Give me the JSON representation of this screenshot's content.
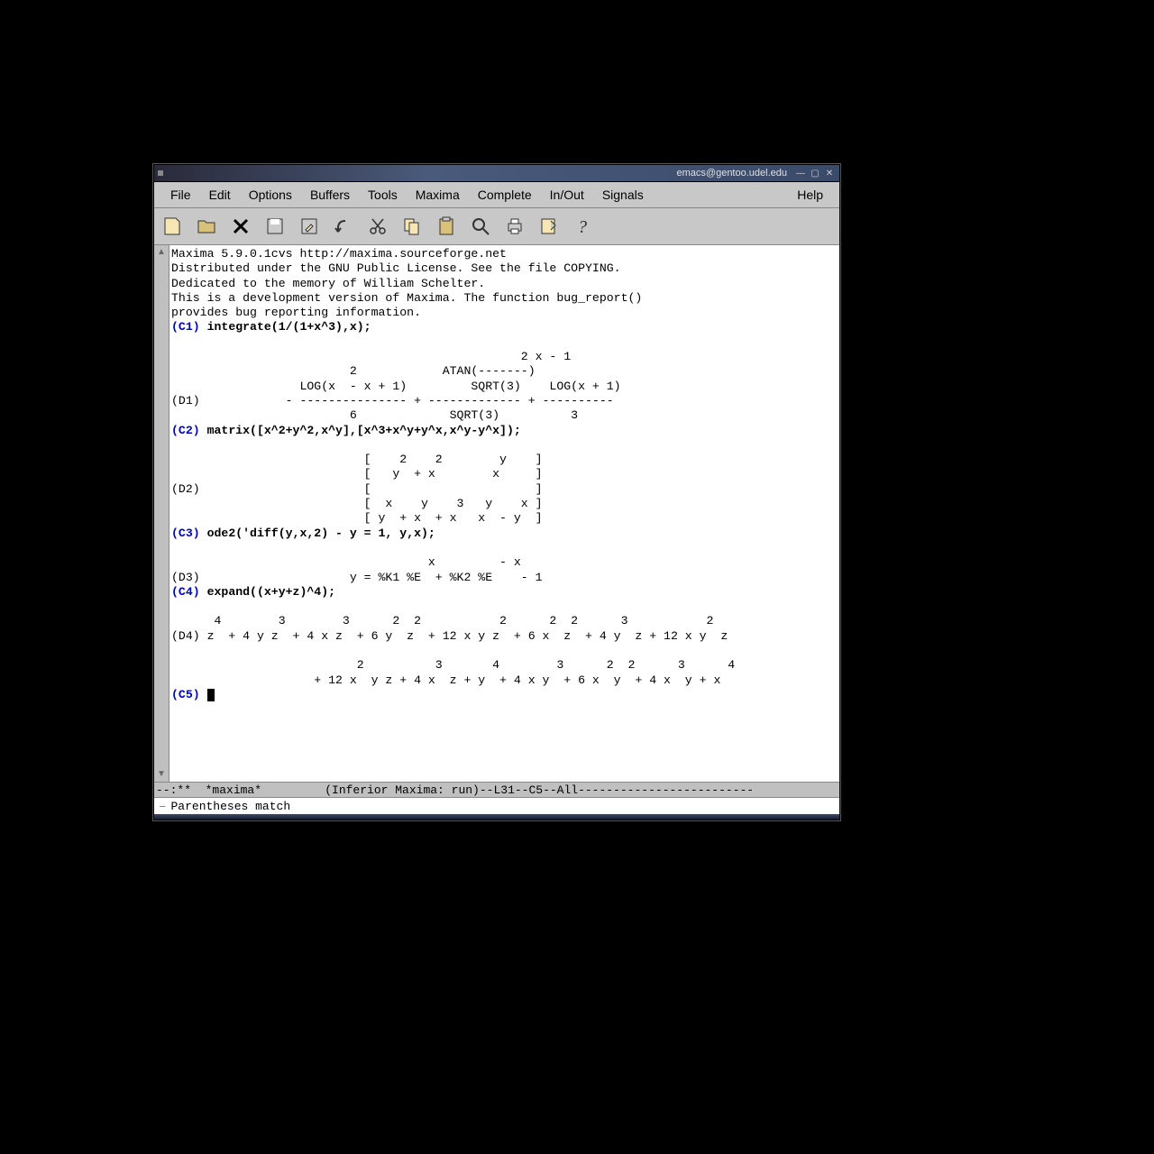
{
  "window": {
    "title": "emacs@gentoo.udel.edu"
  },
  "menu": {
    "file": "File",
    "edit": "Edit",
    "options": "Options",
    "buffers": "Buffers",
    "tools": "Tools",
    "maxima": "Maxima",
    "complete": "Complete",
    "inout": "In/Out",
    "signals": "Signals",
    "help": "Help"
  },
  "header": {
    "l1": "Maxima 5.9.0.1cvs http://maxima.sourceforge.net",
    "l2": "Distributed under the GNU Public License. See the file COPYING.",
    "l3": "Dedicated to the memory of William Schelter.",
    "l4": "This is a development version of Maxima. The function bug_report()",
    "l5": "provides bug reporting information."
  },
  "c1": {
    "label": "(C1) ",
    "cmd": "integrate(1/(1+x^3),x);"
  },
  "d1": {
    "l1": "                                                 2 x - 1",
    "l2": "                         2            ATAN(-------)",
    "l3": "                  LOG(x  - x + 1)         SQRT(3)    LOG(x + 1)",
    "l4": "(D1)            - --------------- + ------------- + ----------",
    "l5": "                         6             SQRT(3)          3"
  },
  "c2": {
    "label": "(C2) ",
    "cmd": "matrix([x^2+y^2,x^y],[x^3+x^y+y^x,x^y-y^x]);"
  },
  "d2": {
    "l1": "                           [    2    2        y    ]",
    "l2": "                           [   y  + x        x     ]",
    "l3": "(D2)                       [                       ]",
    "l4": "                           [  x    y    3   y    x ]",
    "l5": "                           [ y  + x  + x   x  - y  ]"
  },
  "c3": {
    "label": "(C3) ",
    "cmd": "ode2('diff(y,x,2) - y = 1, y,x);"
  },
  "d3": {
    "l1": "                                    x         - x",
    "l2": "(D3)                     y = %K1 %E  + %K2 %E    - 1"
  },
  "c4": {
    "label": "(C4) ",
    "cmd": "expand((x+y+z)^4);"
  },
  "d4": {
    "l1": "      4        3        3      2  2           2      2  2      3           2",
    "l2": "(D4) z  + 4 y z  + 4 x z  + 6 y  z  + 12 x y z  + 6 x  z  + 4 y  z + 12 x y  z",
    "l3": "",
    "l4": "                          2          3       4        3      2  2      3      4",
    "l5": "                    + 12 x  y z + 4 x  z + y  + 4 x y  + 6 x  y  + 4 x  y + x"
  },
  "c5": {
    "label": "(C5) "
  },
  "modeline": "--:**  *maxima*         (Inferior Maxima: run)--L31--C5--All-------------------------",
  "minibuffer": "Parentheses match"
}
